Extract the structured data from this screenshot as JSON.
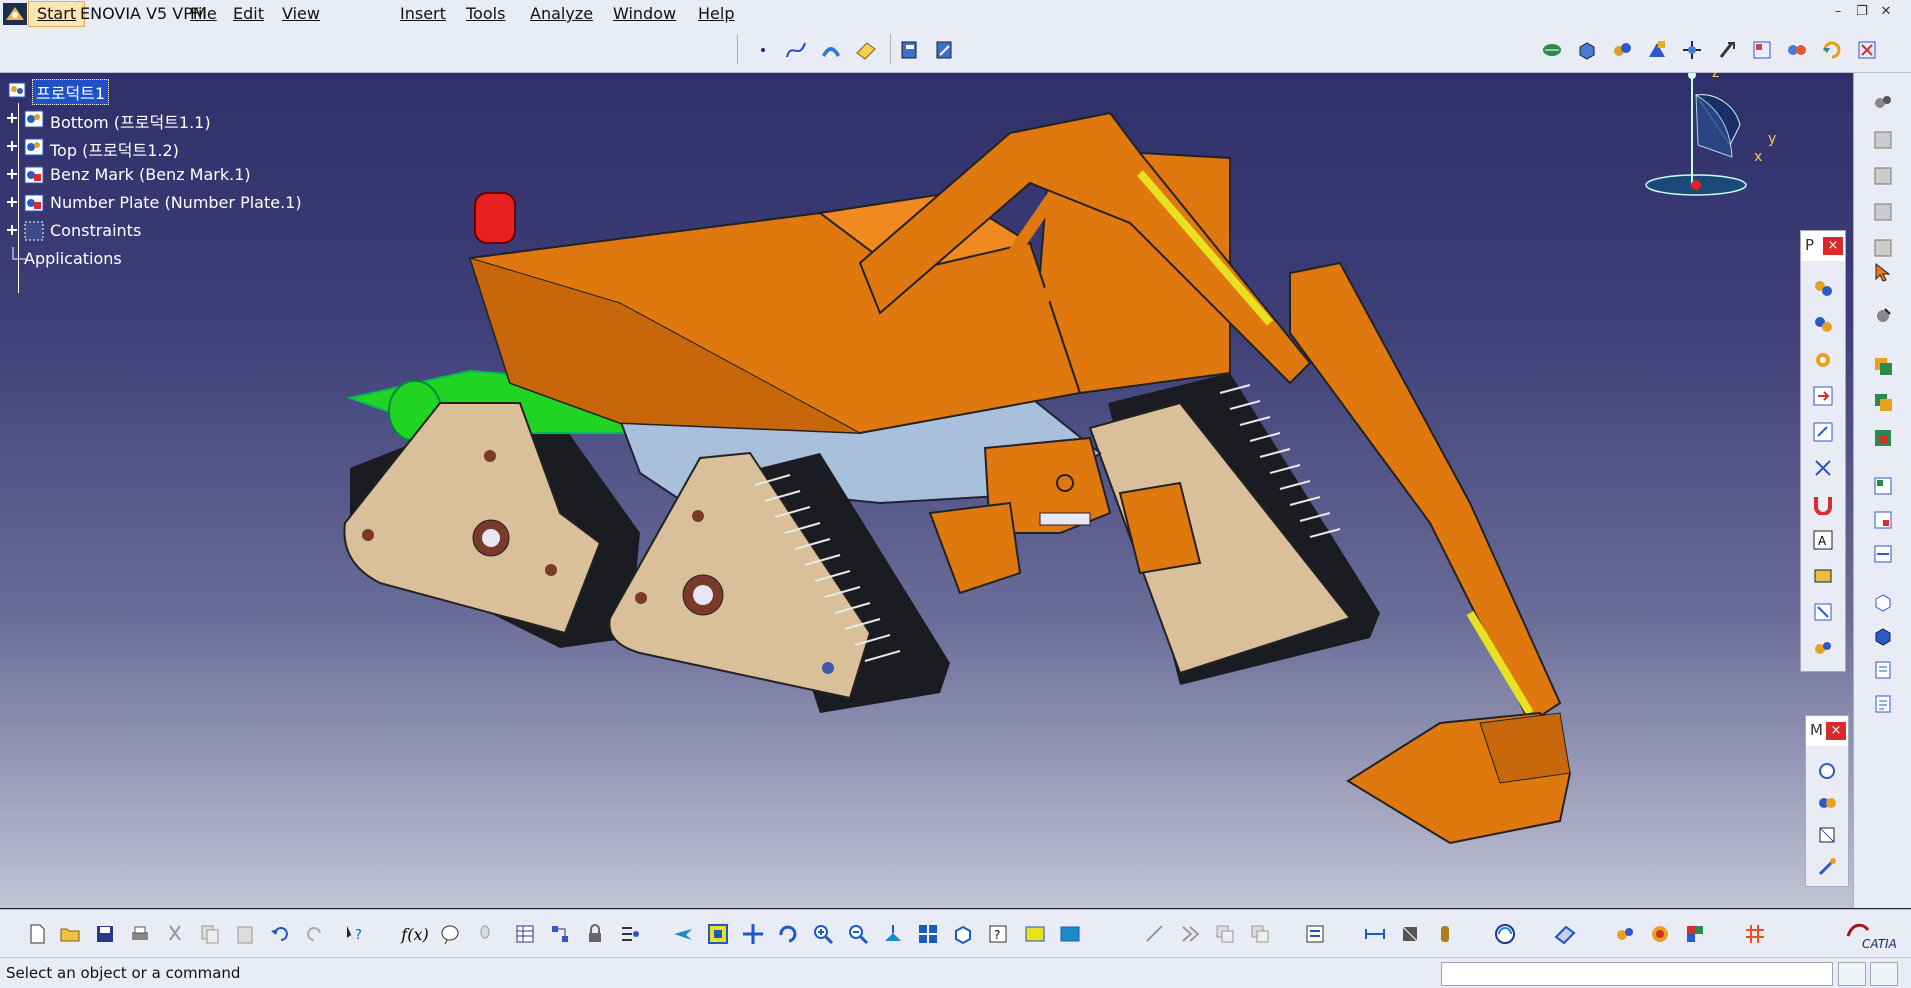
{
  "menubar": {
    "items": [
      "Start",
      "ENOVIA V5 VPM",
      "File",
      "Edit",
      "View",
      "Insert",
      "Tools",
      "Analyze",
      "Window",
      "Help"
    ]
  },
  "tree": {
    "root": "프로덕트1",
    "children": [
      "Bottom (프로덕트1.1)",
      "Top (프로덕트1.2)",
      "Benz Mark (Benz Mark.1)",
      "Number Plate (Number Plate.1)",
      "Constraints",
      "Applications"
    ]
  },
  "compass": {
    "z": "z",
    "y": "y",
    "x": "x"
  },
  "palettes": {
    "p_title": "P",
    "m_title": "M",
    "close": "×"
  },
  "bottom_toolbar": {
    "formula_label": "f(x)"
  },
  "status": {
    "message": "Select an object or a command",
    "cmd_value": ""
  },
  "brand": {
    "name": "CATIA"
  },
  "colors": {
    "arm": "#e07810",
    "track_body": "#d9c09a",
    "chassis": "#a8c0dc",
    "green_part": "#22d422",
    "bg_top": "#2f2f6a"
  }
}
